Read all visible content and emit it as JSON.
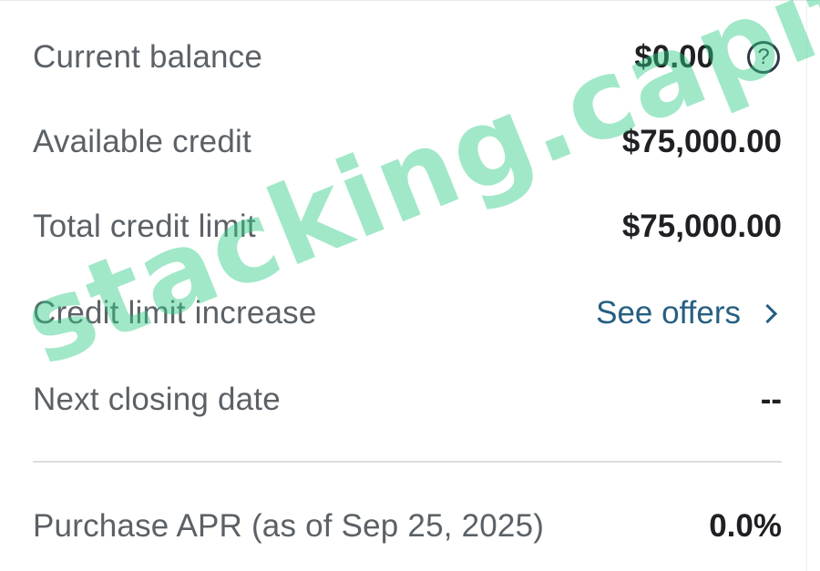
{
  "account_summary": {
    "rows": [
      {
        "label": "Current balance",
        "value": "$0.00"
      },
      {
        "label": "Available credit",
        "value": "$75,000.00"
      },
      {
        "label": "Total credit limit",
        "value": "$75,000.00"
      },
      {
        "label": "Credit limit increase",
        "link_text": "See offers"
      },
      {
        "label": "Next closing date",
        "value": "--"
      }
    ],
    "apr": {
      "label": "Purchase APR (as of Sep 25, 2025)",
      "value": "0.0%"
    }
  },
  "icons": {
    "help": "?",
    "chevron": "chevron-right-icon",
    "help_name": "question-circle-icon"
  },
  "watermark": {
    "text": "stacking.capital",
    "color": "#2ecc84"
  }
}
